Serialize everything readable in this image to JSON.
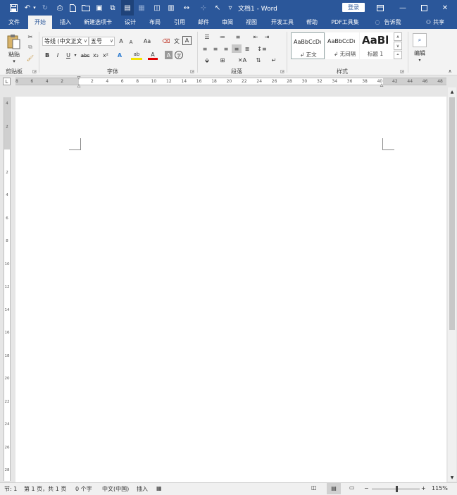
{
  "titlebar": {
    "title": "文档1  -  Word",
    "login_label": "登录",
    "customize_label": "▿"
  },
  "tabs": [
    {
      "label": "文件",
      "active": false
    },
    {
      "label": "开始",
      "active": true
    },
    {
      "label": "插入",
      "active": false
    },
    {
      "label": "新建选项卡",
      "active": false
    },
    {
      "label": "设计",
      "active": false
    },
    {
      "label": "布局",
      "active": false
    },
    {
      "label": "引用",
      "active": false
    },
    {
      "label": "邮件",
      "active": false
    },
    {
      "label": "审阅",
      "active": false
    },
    {
      "label": "视图",
      "active": false
    },
    {
      "label": "开发工具",
      "active": false
    },
    {
      "label": "帮助",
      "active": false
    },
    {
      "label": "PDF工具集",
      "active": false
    }
  ],
  "tellme": {
    "label": "告诉我"
  },
  "share": {
    "label": "共享"
  },
  "ribbon": {
    "clipboard": {
      "paste_label": "粘贴",
      "group_label": "剪贴板"
    },
    "font": {
      "font_name": "等线 (中文正文",
      "font_size": "五号",
      "group_label": "字体",
      "bold": "B",
      "italic": "I",
      "underline": "U",
      "strike": "abc",
      "subscript": "x₂",
      "superscript": "x²",
      "grow": "A",
      "shrink": "A",
      "case": "Aa",
      "highlight": "ab",
      "font_color": "A",
      "shade": "A",
      "circle": "字"
    },
    "paragraph": {
      "group_label": "段落"
    },
    "styles": {
      "group_label": "样式",
      "items": [
        {
          "preview": "AaBbCcDı",
          "name": "↲ 正文"
        },
        {
          "preview": "AaBbCcDı",
          "name": "↲ 无间隔"
        },
        {
          "preview": "AaBl",
          "name": "标题 1"
        }
      ]
    },
    "editing": {
      "label": "编辑"
    }
  },
  "ruler": {
    "h_labels": [
      "8",
      "6",
      "4",
      "2",
      "",
      "2",
      "4",
      "6",
      "8",
      "10",
      "12",
      "14",
      "16",
      "18",
      "20",
      "22",
      "24",
      "26",
      "28",
      "30",
      "32",
      "34",
      "36",
      "38",
      "40",
      "42",
      "44",
      "46",
      "48"
    ],
    "v_labels": [
      "4",
      "2",
      "",
      "2",
      "4",
      "6",
      "8",
      "10",
      "12",
      "14",
      "16",
      "18",
      "20",
      "22",
      "24",
      "26",
      "28"
    ]
  },
  "status": {
    "section": "节: 1",
    "page": "第 1 页，共 1 页",
    "words": "0 个字",
    "language": "中文(中国)",
    "mode": "插入",
    "zoom": "115%",
    "zoom_minus": "−",
    "zoom_plus": "+"
  },
  "colors": {
    "accent": "#2b579a",
    "ribbon_bg": "#f3f3f3",
    "canvas": "#e6e6e6"
  }
}
